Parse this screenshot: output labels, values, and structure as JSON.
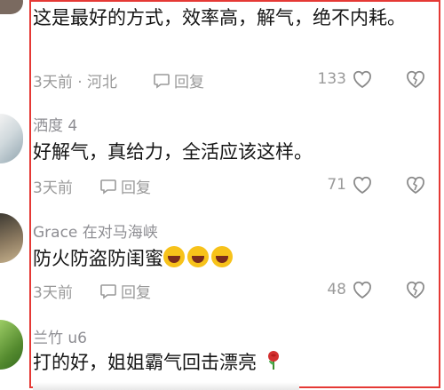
{
  "comments": [
    {
      "user": "",
      "text": "这是最好的方式，效率高，解气，绝不内耗。",
      "time": "3天前 · 河北",
      "reply_label": "回复",
      "likes": "133"
    },
    {
      "user": "洒度 4",
      "text": "好解气，真给力，全活应该这样。",
      "time": "3天前",
      "reply_label": "回复",
      "likes": "71"
    },
    {
      "user": "Grace 在对马海峡",
      "text": "防火防盗防闺蜜",
      "emoji_count": 3,
      "time": "3天前",
      "reply_label": "回复",
      "likes": "48"
    },
    {
      "user": "兰竹 u6",
      "text": "打的好，姐姐霸气回击漂亮",
      "trailing_icon": "rose-icon"
    }
  ],
  "colors": {
    "highlight_border": "#e53935",
    "meta_text": "#9a9a9a"
  }
}
